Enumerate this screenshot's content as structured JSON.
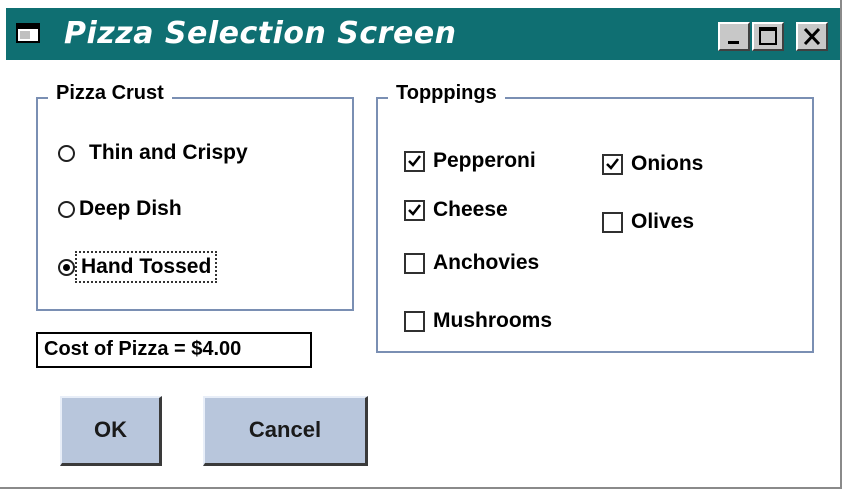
{
  "window": {
    "title": "Pizza Selection Screen",
    "title_bar_color": "#0f6f72",
    "controls": [
      "minimize-icon",
      "maximize-icon",
      "close-icon"
    ]
  },
  "crust": {
    "legend": "Pizza Crust",
    "options": [
      {
        "label": "Thin and Crispy",
        "selected": false
      },
      {
        "label": "Deep Dish",
        "selected": false
      },
      {
        "label": "Hand Tossed",
        "selected": true
      }
    ]
  },
  "toppings": {
    "legend": "Topppings",
    "items": [
      {
        "label": "Pepperoni",
        "checked": true
      },
      {
        "label": "Cheese",
        "checked": true
      },
      {
        "label": "Anchovies",
        "checked": false
      },
      {
        "label": "Mushrooms",
        "checked": false
      },
      {
        "label": "Onions",
        "checked": true
      },
      {
        "label": "Olives",
        "checked": false
      }
    ]
  },
  "cost_label": "Cost of Pizza = $4.00",
  "buttons": {
    "ok": "OK",
    "cancel": "Cancel"
  },
  "colors": {
    "button_face": "#b8c6dc",
    "group_border": "#7a8fb3"
  }
}
